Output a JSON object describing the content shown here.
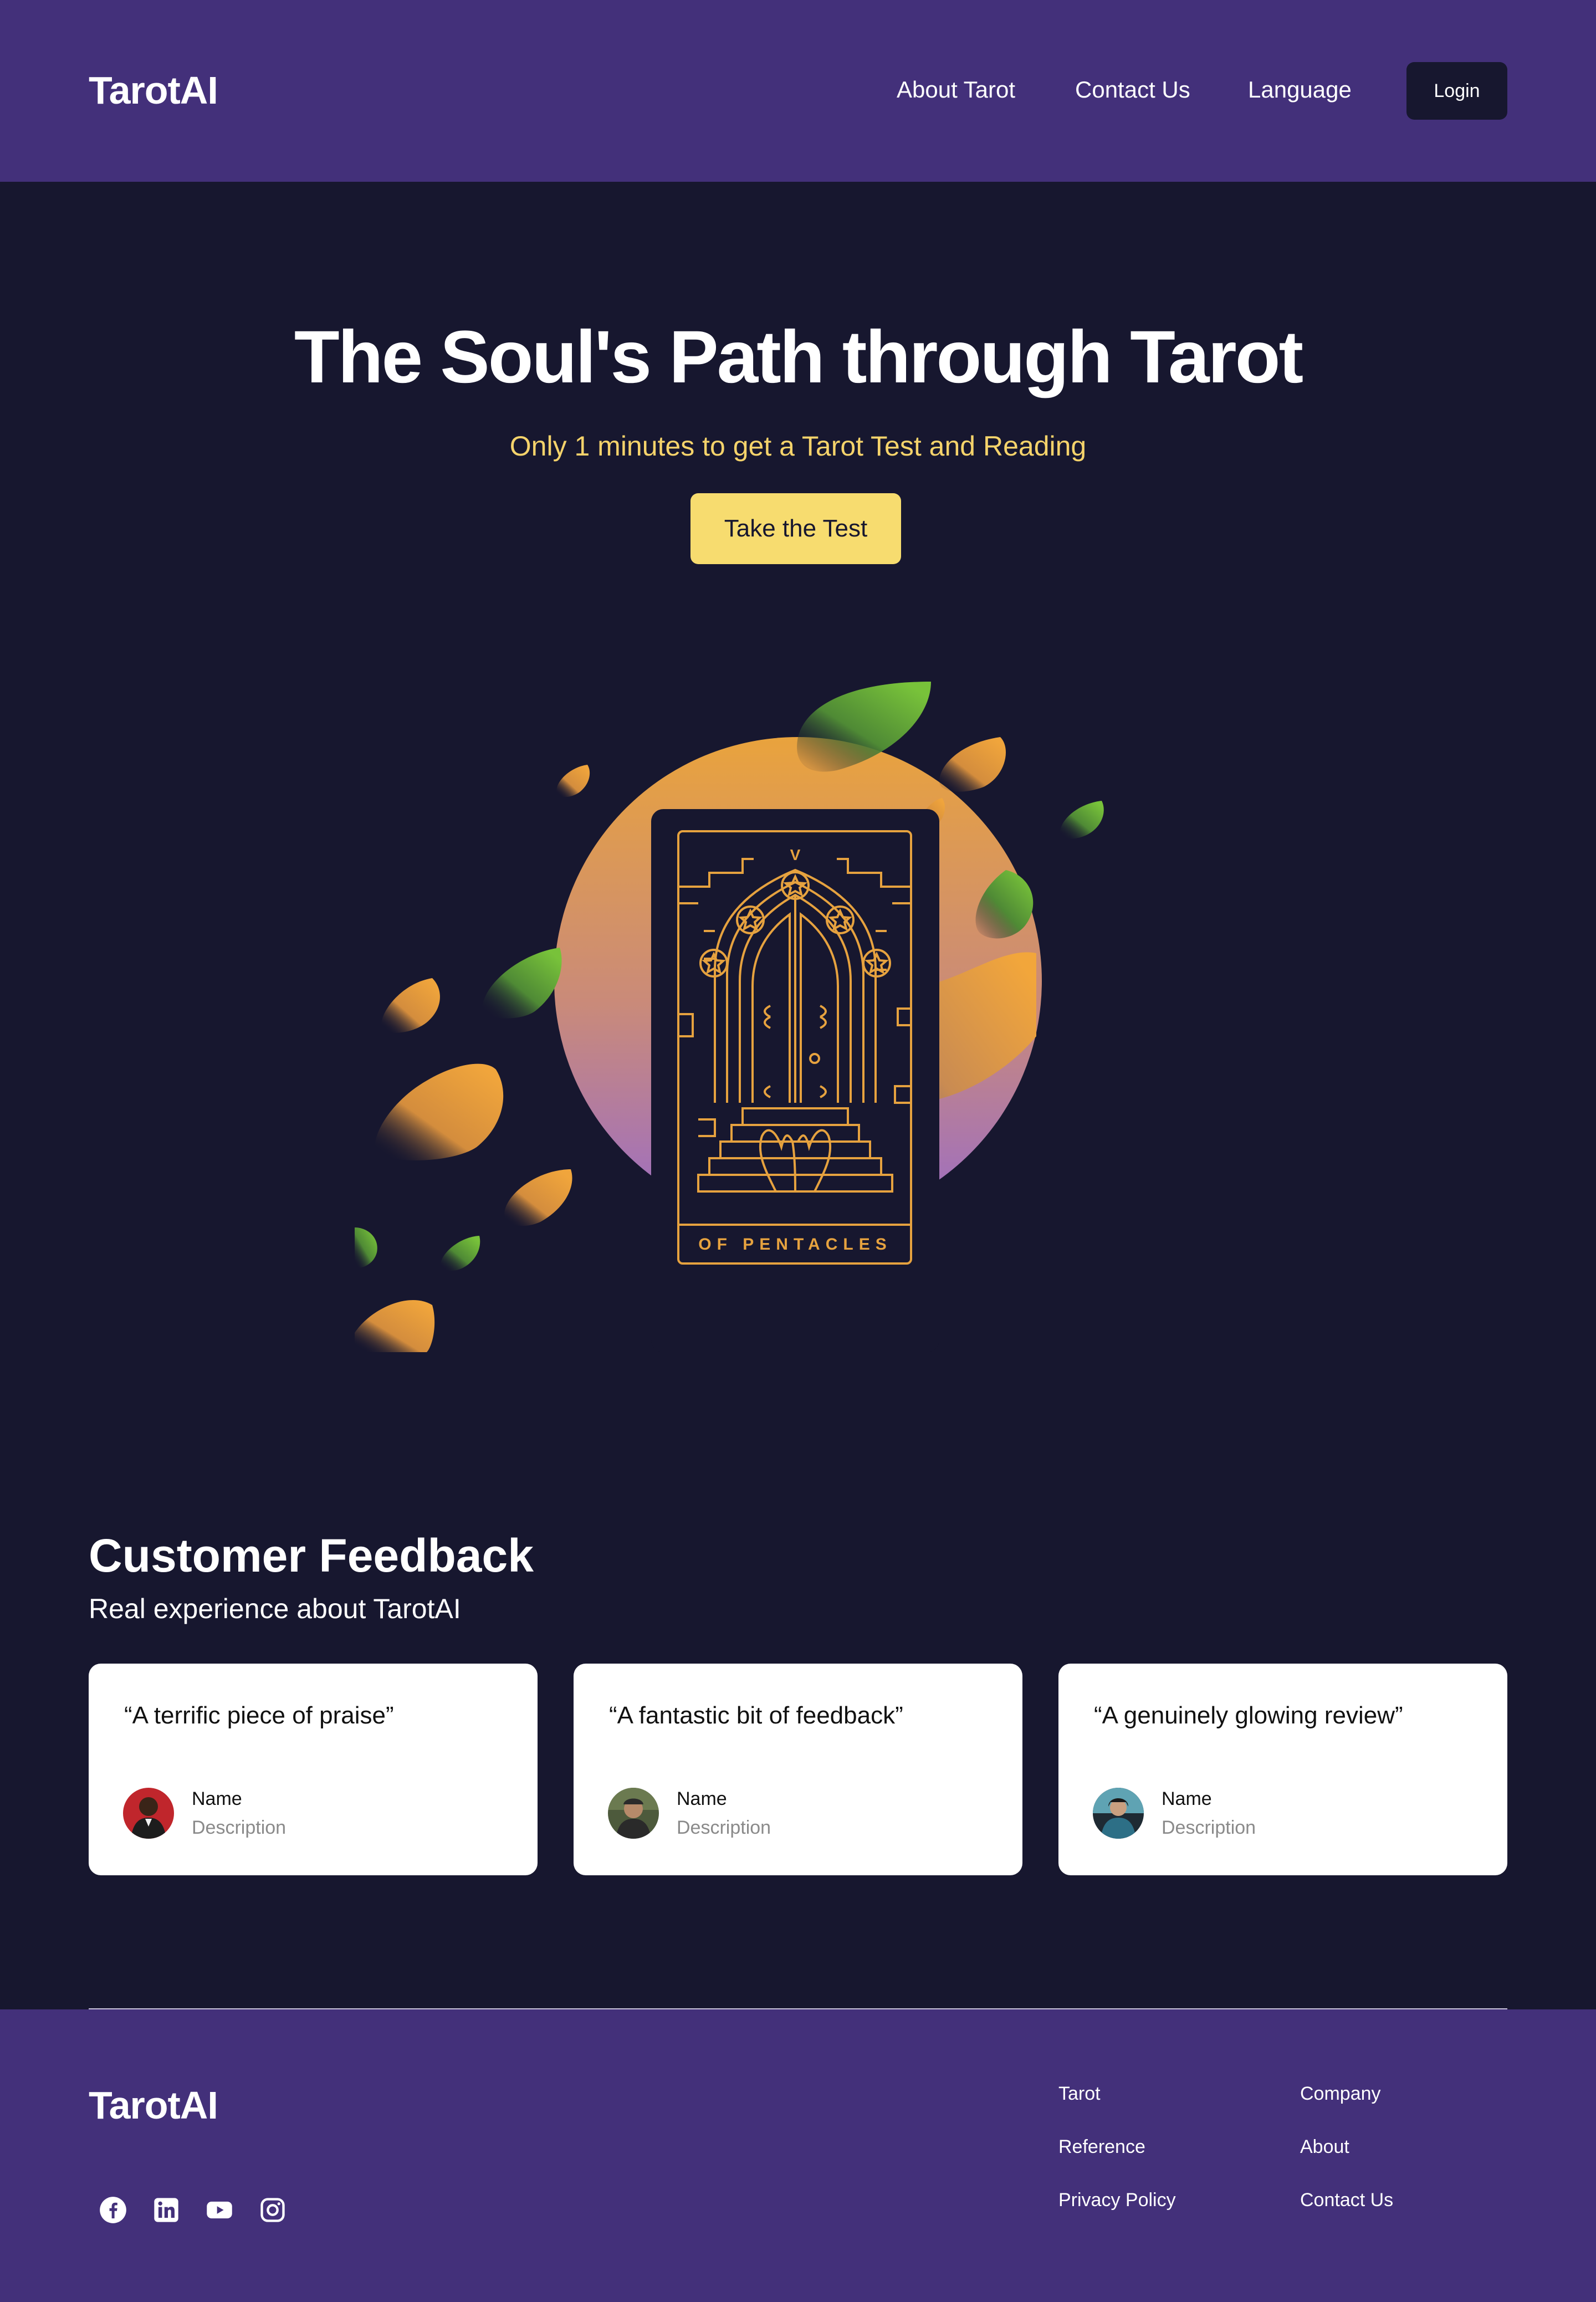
{
  "header": {
    "logo": "TarotAI",
    "nav": [
      "About Tarot",
      "Contact Us",
      "Language"
    ],
    "login": "Login"
  },
  "hero": {
    "title": "The Soul's Path through Tarot",
    "subtitle": "Only 1 minutes to get a Tarot Test and Reading",
    "cta": "Take the Test",
    "card": {
      "numeral": "V",
      "caption": "OF PENTACLES"
    }
  },
  "feedback": {
    "title": "Customer Feedback",
    "subtitle": "Real experience about TarotAI",
    "cards": [
      {
        "quote": "“A terrific piece of praise”",
        "name": "Name",
        "description": "Description"
      },
      {
        "quote": "“A fantastic bit of feedback”",
        "name": "Name",
        "description": "Description"
      },
      {
        "quote": "“A genuinely glowing review”",
        "name": "Name",
        "description": "Description"
      }
    ]
  },
  "footer": {
    "logo": "TarotAI",
    "social_icons": [
      "facebook-icon",
      "linkedin-icon",
      "youtube-icon",
      "instagram-icon"
    ],
    "col1": [
      "Tarot",
      "Reference",
      "Privacy Policy"
    ],
    "col2": [
      "Company",
      "About",
      "Contact Us"
    ]
  },
  "colors": {
    "header_bg": "#43307a",
    "page_bg": "#17172f",
    "accent_yellow": "#f7dc6f",
    "card_line_gold": "#e6a23f",
    "leaf_green": "#6fb83a",
    "circle_purple": "#9a6cc8"
  }
}
